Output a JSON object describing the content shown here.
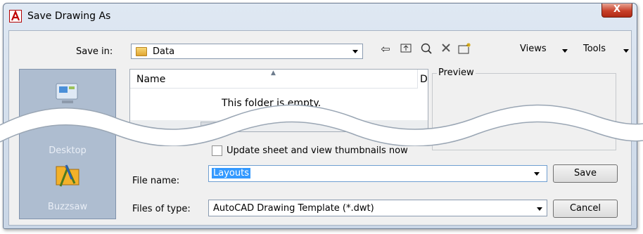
{
  "window": {
    "title": "Save Drawing As",
    "close_label": "X"
  },
  "toolbar": {
    "save_in_label": "Save in:",
    "save_in_value": "Data",
    "views_label": "Views",
    "tools_label": "Tools"
  },
  "places": [
    {
      "label": "Desktop"
    },
    {
      "label": "Buzzsaw"
    }
  ],
  "filelist": {
    "columns": [
      "Name",
      "D"
    ],
    "empty_message": "This folder is empty.",
    "scroll_grip": "III"
  },
  "preview": {
    "label": "Preview"
  },
  "options": {
    "update_thumbnails_label": "Update sheet and view thumbnails now",
    "update_thumbnails_checked": false
  },
  "form": {
    "file_name_label": "File name:",
    "file_name_value": "Layouts",
    "files_of_type_label": "Files of type:",
    "files_of_type_value": "AutoCAD Drawing Template (*.dwt)"
  },
  "buttons": {
    "save": "Save",
    "cancel": "Cancel"
  },
  "icons": [
    "back-icon",
    "up-folder-icon",
    "search-web-icon",
    "delete-icon",
    "new-folder-icon"
  ]
}
